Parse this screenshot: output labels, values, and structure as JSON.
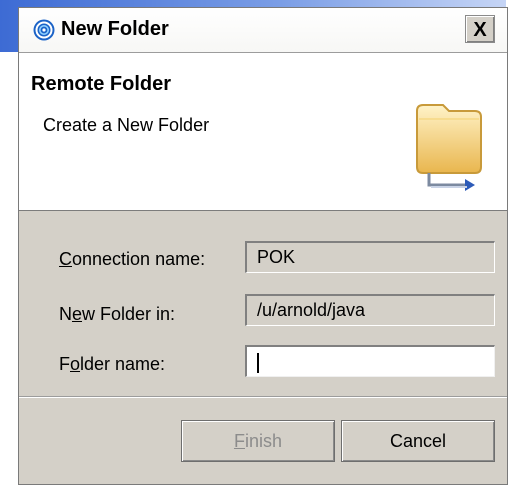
{
  "window": {
    "title": "New Folder",
    "close_label": "X"
  },
  "header": {
    "title": "Remote Folder",
    "description": "Create a New Folder"
  },
  "fields": {
    "connection": {
      "label": "Connection name:",
      "value": "POK"
    },
    "parent": {
      "label": "New Folder in:",
      "value": "/u/arnold/java"
    },
    "name": {
      "label": "Folder name:",
      "value": ""
    }
  },
  "buttons": {
    "finish": {
      "label": "Finish",
      "enabled": false
    },
    "cancel": {
      "label": "Cancel",
      "enabled": true
    }
  },
  "icons": {
    "title": "eclipse-swirl-icon",
    "header": "folder-with-arrow-icon"
  },
  "colors": {
    "dialog_bg": "#d4d0c8",
    "banner_blue": "#3d6bd4",
    "disabled_text": "#8c8c8c"
  }
}
